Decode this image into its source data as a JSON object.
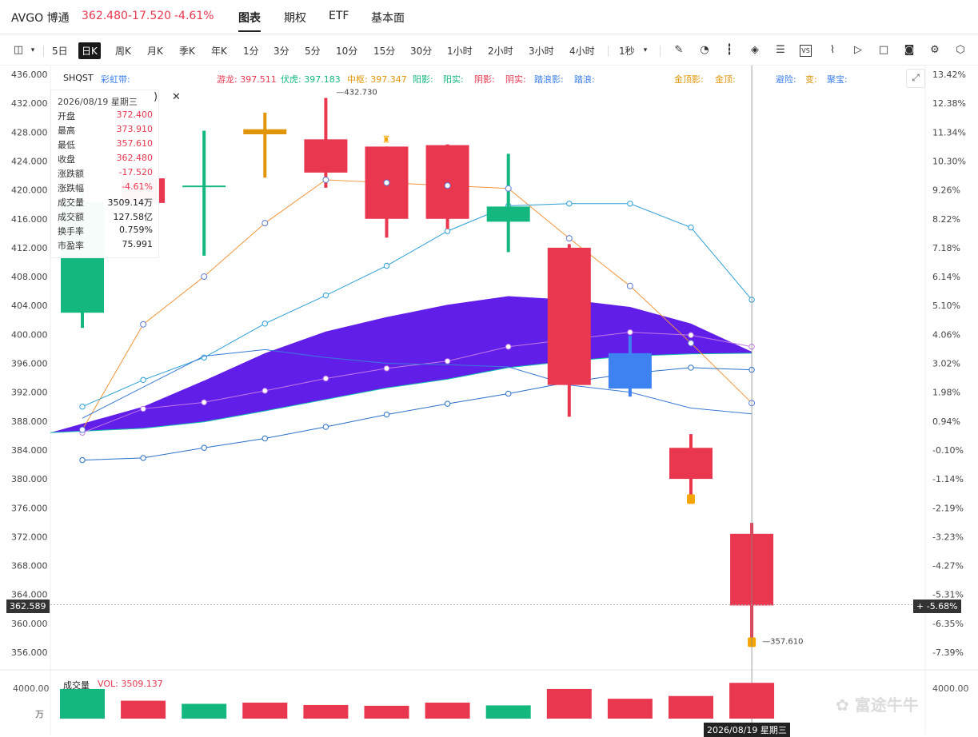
{
  "header": {
    "ticker": "AVGO 博通",
    "price": "362.480",
    "change": "-17.520",
    "change_pct": "-4.61%",
    "tabs": [
      "图表",
      "期权",
      "ETF",
      "基本面"
    ]
  },
  "toolbar": {
    "periods": [
      "5日",
      "日K",
      "周K",
      "月K",
      "季K",
      "年K",
      "1分",
      "3分",
      "5分",
      "10分",
      "15分",
      "30分",
      "1小时",
      "2小时",
      "3小时",
      "4小时"
    ],
    "active_period": "日K",
    "interval": "1秒",
    "icons": [
      "layout-icon",
      "pen-icon",
      "speedometer-icon",
      "candle-icon",
      "layers-icon",
      "list-icon",
      "vs-icon",
      "chart-line-icon",
      "replay-icon",
      "square-icon",
      "camera-icon",
      "settings-icon"
    ]
  },
  "legend": {
    "indicator": "SHQST",
    "band": "彩虹带:",
    "youlong": "游龙: 397.511",
    "fuhu": "伏虎: 397.183",
    "zhongshu": "中枢: 397.347",
    "yangying": "阳影:",
    "yangshi": "阳实:",
    "yinying": "阴影:",
    "yinshi": "阴实:",
    "talangying": "踏浪影:",
    "talang": "踏浪:",
    "jindingying": "金顶影:",
    "jinding": "金顶:",
    "bixian": "避险:",
    "bian": "变:",
    "jubao": "聚宝:"
  },
  "tooltip": {
    "date": "2026/08/19 星期三",
    "rows": [
      {
        "k": "开盘",
        "v": "372.400",
        "c": "red"
      },
      {
        "k": "最高",
        "v": "373.910",
        "c": "red"
      },
      {
        "k": "最低",
        "v": "357.610",
        "c": "red"
      },
      {
        "k": "收盘",
        "v": "362.480",
        "c": "red"
      },
      {
        "k": "涨跌额",
        "v": "-17.520",
        "c": "red"
      },
      {
        "k": "涨跌幅",
        "v": "-4.61%",
        "c": "red"
      },
      {
        "k": "成交量",
        "v": "3509.14万",
        "c": "black"
      },
      {
        "k": "成交额",
        "v": "127.58亿",
        "c": "black"
      },
      {
        "k": "换手率",
        "v": "0.759%",
        "c": "black"
      },
      {
        "k": "市盈率",
        "v": "75.991",
        "c": "black"
      }
    ]
  },
  "crosshair": {
    "price_label": "362.589",
    "pct_label": "-5.68%",
    "date_label": "2026/08/19 星期三"
  },
  "volume": {
    "label": "成交量",
    "vol_text": "VOL: 3509.137",
    "left_tick": "4000.00",
    "left_unit": "万",
    "right_tick": "4000.00"
  },
  "watermark": "富途牛牛",
  "chart_data": {
    "type": "candlestick",
    "y_ticks": [
      "436.000",
      "432.000",
      "428.000",
      "424.000",
      "420.000",
      "416.000",
      "412.000",
      "408.000",
      "404.000",
      "400.000",
      "396.000",
      "392.000",
      "388.000",
      "384.000",
      "380.000",
      "376.000",
      "372.000",
      "368.000",
      "364.000",
      "360.000",
      "356.000"
    ],
    "y_tick_values": [
      436,
      432,
      428,
      424,
      420,
      416,
      412,
      408,
      404,
      400,
      396,
      392,
      388,
      384,
      380,
      376,
      372,
      368,
      364,
      360,
      356
    ],
    "pct_ticks": [
      "13.42%",
      "12.38%",
      "11.34%",
      "10.30%",
      "9.26%",
      "8.22%",
      "7.18%",
      "6.14%",
      "5.10%",
      "4.06%",
      "3.02%",
      "1.98%",
      "0.94%",
      "-0.10%",
      "-1.14%",
      "-2.19%",
      "-3.23%",
      "-4.27%",
      "-5.31%",
      "-6.35%",
      "-7.39%"
    ],
    "ylim": [
      354,
      437
    ],
    "candles": [
      {
        "o": 418.3,
        "h": 419.5,
        "l": 400.9,
        "c": 403.0,
        "color": "green"
      },
      {
        "o": 418.2,
        "h": 421.8,
        "l": 418.0,
        "c": 421.6,
        "color": "red"
      },
      {
        "o": 420.6,
        "h": 428.2,
        "l": 410.9,
        "c": 420.6,
        "color": "green"
      },
      {
        "o": 427.7,
        "h": 430.7,
        "l": 421.7,
        "c": 428.4,
        "color": "orange"
      },
      {
        "o": 422.4,
        "h": 432.73,
        "l": 420.3,
        "c": 427.0,
        "color": "red"
      },
      {
        "o": 416.0,
        "h": 426.0,
        "l": 413.4,
        "c": 426.0,
        "color": "red"
      },
      {
        "o": 416.0,
        "h": 426.3,
        "l": 414.6,
        "c": 426.2,
        "color": "red"
      },
      {
        "o": 417.7,
        "h": 425.0,
        "l": 411.4,
        "c": 415.6,
        "color": "green"
      },
      {
        "o": 393.0,
        "h": 412.5,
        "l": 388.6,
        "c": 412.0,
        "color": "red"
      },
      {
        "o": 392.5,
        "h": 399.8,
        "l": 391.4,
        "c": 397.4,
        "color": "blue"
      },
      {
        "o": 380.0,
        "h": 386.2,
        "l": 377.0,
        "c": 384.3,
        "color": "red"
      },
      {
        "o": 362.48,
        "h": 373.91,
        "l": 357.61,
        "c": 372.4,
        "color": "red"
      }
    ],
    "annotations": [
      {
        "text": "432.730",
        "candle": 4
      },
      {
        "text": "357.610",
        "candle": 11
      }
    ],
    "orange_line": [
      386.8,
      401.4,
      408.0,
      415.4,
      421.4,
      421.0,
      420.6,
      420.2,
      413.3,
      406.7,
      398.8,
      390.5
    ],
    "blue_upper": [
      390.0,
      393.7,
      396.8,
      401.5,
      405.4,
      409.5,
      414.3,
      417.8,
      418.1,
      418.1,
      414.8,
      404.8
    ],
    "blue_lower": [
      382.6,
      382.9,
      384.3,
      385.6,
      387.2,
      388.9,
      390.4,
      391.8,
      393.4,
      394.6,
      395.4,
      395.1
    ],
    "blue_mid": [
      388.4,
      392.7,
      397.0,
      397.9,
      396.8,
      396.0,
      395.8,
      395.5,
      393.0,
      392.0,
      389.8,
      389.0
    ],
    "purple_line": [
      386.4,
      389.7,
      390.6,
      392.2,
      393.9,
      395.3,
      396.3,
      398.3,
      399.3,
      400.3,
      399.9,
      398.3
    ],
    "band_top": [
      386.4,
      390.0,
      393.6,
      397.4,
      400.4,
      402.4,
      404.1,
      405.3,
      404.8,
      403.8,
      401.5,
      397.6
    ],
    "band_bottom": [
      386.4,
      387.0,
      387.9,
      389.4,
      391.0,
      392.6,
      393.8,
      395.4,
      396.3,
      397.0,
      397.3,
      397.4
    ],
    "volumes": [
      {
        "v": 3800,
        "color": "green"
      },
      {
        "v": 2300,
        "color": "red"
      },
      {
        "v": 1900,
        "color": "green"
      },
      {
        "v": 2050,
        "color": "red"
      },
      {
        "v": 1750,
        "color": "red"
      },
      {
        "v": 1650,
        "color": "red"
      },
      {
        "v": 2050,
        "color": "red"
      },
      {
        "v": 1700,
        "color": "green"
      },
      {
        "v": 3800,
        "color": "red"
      },
      {
        "v": 2550,
        "color": "red"
      },
      {
        "v": 2900,
        "color": "red"
      },
      {
        "v": 4590,
        "color": "red"
      }
    ],
    "colors": {
      "red": "#e8374f",
      "green": "#14b87e",
      "orange": "#e0950a",
      "blue": "#3d82f0",
      "purple": "#5a12e8"
    }
  }
}
